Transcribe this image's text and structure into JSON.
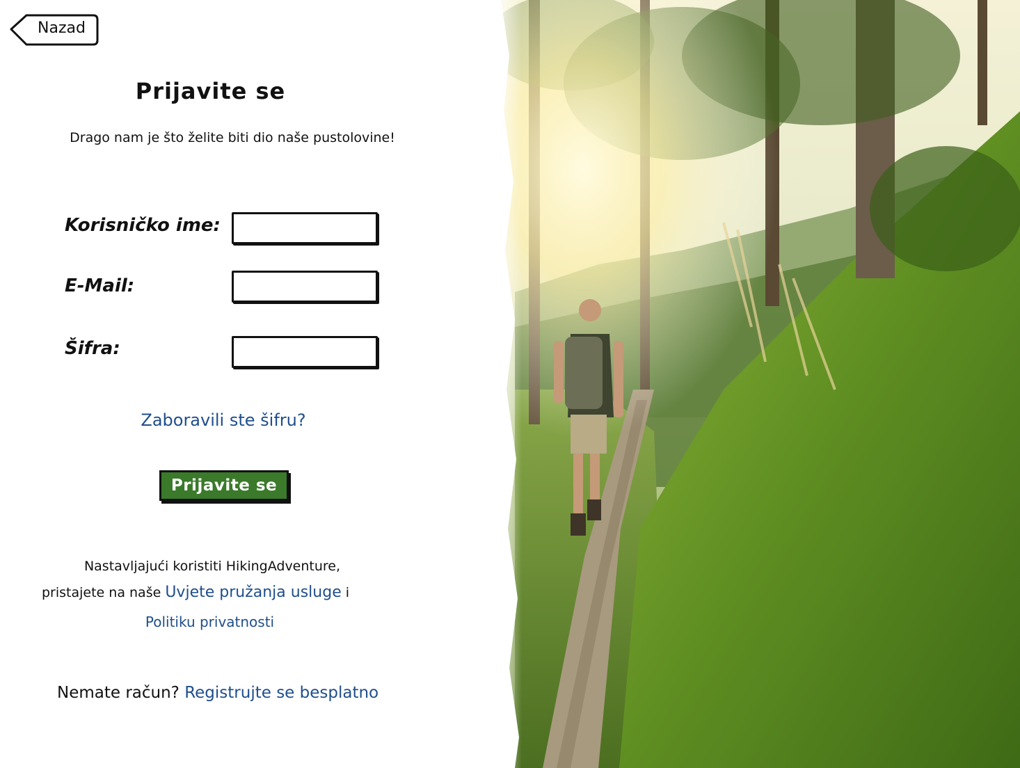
{
  "back_button": {
    "label": "Nazad",
    "icon": "back-arrow-icon"
  },
  "header": {
    "title": "Prijavite se",
    "subtitle": "Drago nam je što želite biti dio naše pustolovine!"
  },
  "form": {
    "username_label": "Korisničko ime:",
    "email_label": "E-Mail:",
    "password_label": "Šifra:",
    "username_value": "",
    "email_value": "",
    "password_value": ""
  },
  "forgot_password": "Zaboravili ste šifru?",
  "submit_label": "Prijavite se",
  "terms": {
    "line1": "Nastavljajući koristiti HikingAdventure,",
    "line2_prefix": "pristajete na naše ",
    "terms_link": "Uvjete pružanja usluge",
    "conjunction": " i",
    "privacy_link": "Politiku privatnosti"
  },
  "register": {
    "prompt": "Nemate račun? ",
    "link": "Registrujte se besplatno"
  },
  "colors": {
    "accent_green": "#3a7a2a",
    "link_blue": "#1f4e8c"
  }
}
